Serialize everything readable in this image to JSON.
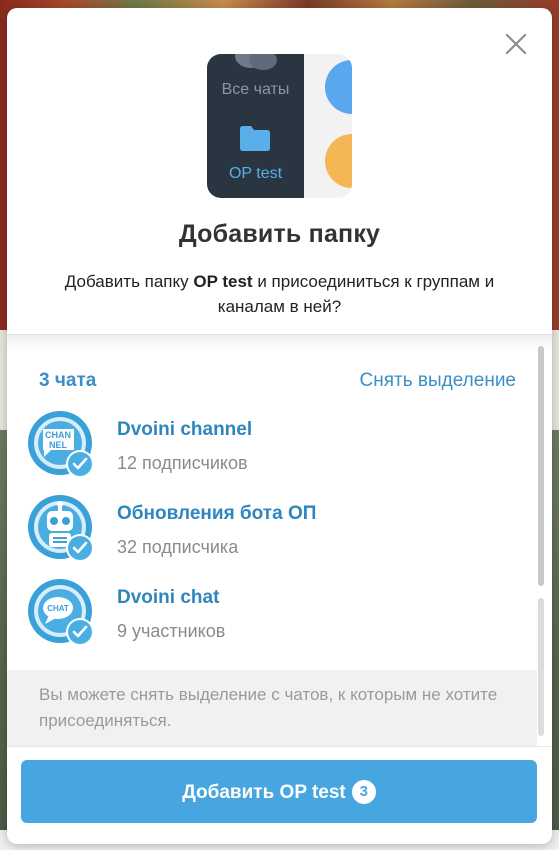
{
  "dialog": {
    "illustration": {
      "all_chats_label": "Все чаты",
      "folder_label": "OP test"
    },
    "title": "Добавить папку",
    "subtitle_prefix": "Добавить папку ",
    "subtitle_folder": "OP test",
    "subtitle_suffix": " и присоединиться к группам и каналам в ней?",
    "list_header": {
      "count": "3 чата",
      "deselect": "Снять выделение"
    },
    "chats": [
      {
        "name": "Dvoini channel",
        "subtitle": "12 подписчиков",
        "avatar_text": "CHAN NEL",
        "icon": "channel-avatar-icon"
      },
      {
        "name": "Обновления бота ОП",
        "subtitle": "32 подписчика",
        "avatar_text": "",
        "icon": "robot-avatar-icon"
      },
      {
        "name": "Dvoini chat",
        "subtitle": "9 участников",
        "avatar_text": "CHAT",
        "icon": "chat-avatar-icon"
      }
    ],
    "note": "Вы можете снять выделение с чатов, к которым не хотите присоединяться.",
    "add_button": {
      "label": "Добавить OP test",
      "badge": "3"
    }
  },
  "colors": {
    "accent": "#47a6df",
    "link": "#3a8fc6",
    "dark_panel": "#2a3542"
  }
}
